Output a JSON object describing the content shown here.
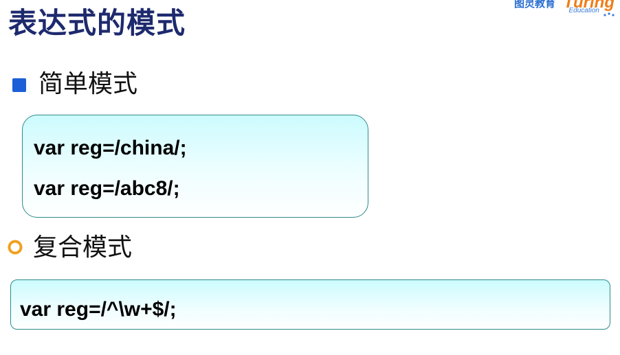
{
  "slide": {
    "title": "表达式的模式"
  },
  "logo": {
    "chinese": "图灵教育",
    "english": "Turing",
    "sub": "Education"
  },
  "sections": [
    {
      "heading": "简单模式",
      "bullet_icon": "blue-square",
      "code_lines": [
        "var reg=/china/;",
        "var reg=/abc8/;"
      ]
    },
    {
      "heading": "复合模式",
      "bullet_icon": "orange-ring",
      "code_lines": [
        "var reg=/^\\w+$/;"
      ]
    }
  ],
  "colors": {
    "title": "#1e2a6e",
    "bullet_square": "#1d5fd6",
    "bullet_ring": "#f0a020",
    "code_box_border": "#2c8a8a",
    "code_box_fill": "#ccfbfe",
    "logo_blue": "#2a6fd1",
    "logo_orange": "#f07d18"
  }
}
